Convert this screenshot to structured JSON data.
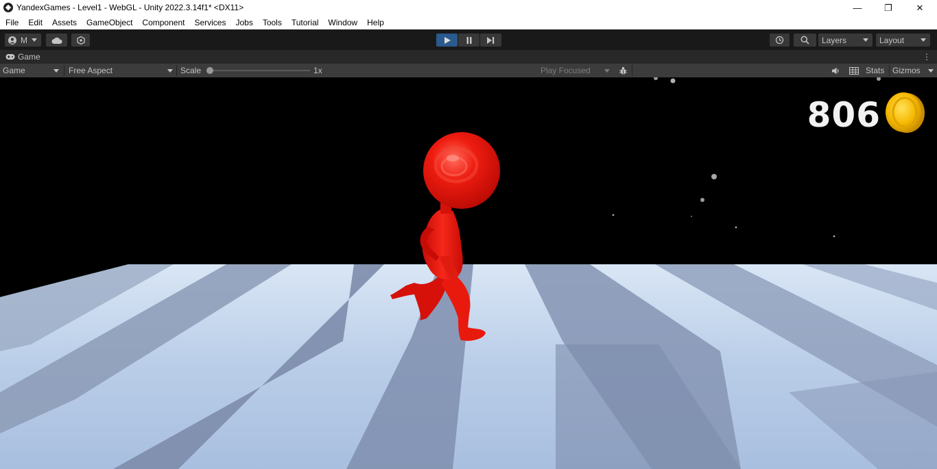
{
  "window": {
    "title": "YandexGames - Level1 - WebGL - Unity 2022.3.14f1* <DX11>",
    "controls": [
      "—",
      "❐",
      "✕"
    ]
  },
  "menu": [
    "File",
    "Edit",
    "Assets",
    "GameObject",
    "Component",
    "Services",
    "Jobs",
    "Tools",
    "Tutorial",
    "Window",
    "Help"
  ],
  "toolbar": {
    "account_label": "M",
    "layers_label": "Layers",
    "layout_label": "Layout"
  },
  "game_tab": {
    "label": "Game"
  },
  "game_controls": {
    "display_select": "Game",
    "aspect_select": "Free Aspect",
    "scale_label": "Scale",
    "scale_value": "1x",
    "play_mode_select": "Play Focused",
    "stats_label": "Stats",
    "gizmos_label": "Gizmos"
  },
  "game_view": {
    "score": "806",
    "character_color": "#e8120c",
    "coin_color": "#f2b705"
  }
}
